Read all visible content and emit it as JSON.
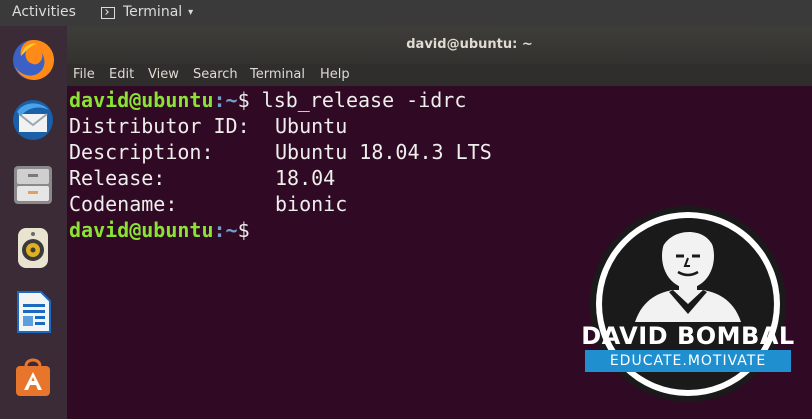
{
  "topbar": {
    "activities": "Activities",
    "app_menu": "Terminal",
    "caret": "▾"
  },
  "dock": {
    "items": [
      {
        "name": "firefox-icon"
      },
      {
        "name": "thunderbird-icon"
      },
      {
        "name": "files-icon"
      },
      {
        "name": "rhythmbox-icon"
      },
      {
        "name": "libreoffice-writer-icon"
      },
      {
        "name": "software-center-icon"
      }
    ]
  },
  "window": {
    "title": "david@ubuntu: ~",
    "menu": [
      "File",
      "Edit",
      "View",
      "Search",
      "Terminal",
      "Help"
    ]
  },
  "terminal": {
    "prompt_user": "david@ubuntu",
    "prompt_path": ":~",
    "prompt_symbol": "$",
    "command": " lsb_release -idrc",
    "rows": [
      {
        "label": "Distributor ID:",
        "value": "Ubuntu"
      },
      {
        "label": "Description:",
        "value": "Ubuntu 18.04.3 LTS"
      },
      {
        "label": "Release:",
        "value": "18.04"
      },
      {
        "label": "Codename:",
        "value": "bionic"
      }
    ]
  },
  "watermark": {
    "name": "DAVID BOMBAL",
    "tagline": "EDUCATE.MOTIVATE"
  },
  "colors": {
    "terminal_bg": "#300a24",
    "prompt_user": "#8ae234",
    "prompt_path": "#729fcf",
    "dock_bg": "#3b2b37",
    "brand_blue": "#1f8fd0"
  }
}
